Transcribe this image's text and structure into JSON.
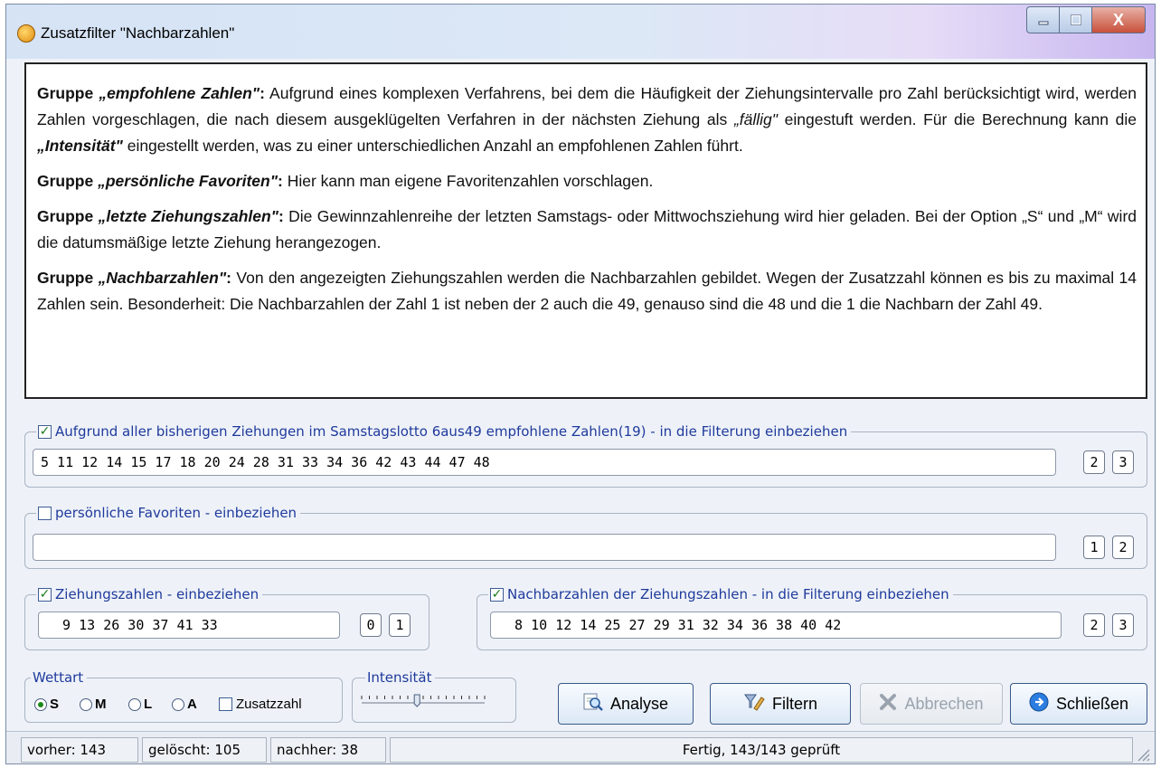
{
  "window": {
    "title": "Zusatzfilter \"Nachbarzahlen\"",
    "controls": {
      "minimize": "_",
      "maximize": "□",
      "close": "X"
    }
  },
  "description": [
    {
      "lead": "Gruppe ",
      "name": "„empfohlene Zahlen\"",
      "colon": ":",
      "text_parts": [
        {
          "t": " Aufgrund eines komplexen Verfahrens, bei dem die Häufigkeit der Ziehungsintervalle pro Zahl berücksichtigt wird, werden Zahlen vorgeschlagen, die nach diesem ausgeklügelten Verfahren in der nächsten Ziehung als "
        },
        {
          "t": "„fällig\"",
          "style": "i"
        },
        {
          "t": " eingestuft werden. Für die Berechnung kann die "
        },
        {
          "t": "„Intensität\"",
          "style": "bi"
        },
        {
          "t": " eingestellt werden, was zu einer unterschiedlichen Anzahl an empfohlenen Zahlen führt."
        }
      ]
    },
    {
      "lead": "Gruppe ",
      "name": "„persönliche Favoriten\"",
      "colon": ":",
      "text_parts": [
        {
          "t": " Hier kann man eigene Favoritenzahlen vorschlagen."
        }
      ]
    },
    {
      "lead": "Gruppe ",
      "name": "„letzte Ziehungszahlen\"",
      "colon": ":",
      "text_parts": [
        {
          "t": " Die Gewinnzahlenreihe der letzten Samstags- oder Mittwochsziehung wird hier geladen. Bei der Option „S“ und „M“ wird die datumsmäßige letzte Ziehung herangezogen."
        }
      ]
    },
    {
      "lead": "Gruppe ",
      "name": "„Nachbarzahlen\"",
      "colon": ":",
      "text_parts": [
        {
          "t": " Von den angezeigten Ziehungszahlen werden die Nachbarzahlen gebildet. Wegen der Zusatzzahl können es bis zu maximal 14 Zahlen sein. Besonderheit: Die Nachbarzahlen der Zahl 1 ist neben der 2 auch die 49, genauso sind die 48 und die 1 die Nachbarn der Zahl 49."
        }
      ]
    }
  ],
  "groups": {
    "recommended": {
      "label": "Aufgrund aller bisherigen Ziehungen im Samstagslotto 6aus49 empfohlene Zahlen(19) - in die Filterung einbeziehen",
      "checked": true,
      "value": "5 11 12 14 15 17 18 20 24 28 31 33 34 36 42 43 44 47 48",
      "btn_a": "2",
      "btn_b": "3"
    },
    "favorites": {
      "label": "persönliche Favoriten  - einbeziehen",
      "checked": false,
      "value": "",
      "btn_a": "1",
      "btn_b": "2"
    },
    "draw": {
      "label": "Ziehungszahlen -  einbeziehen",
      "checked": true,
      "value": "  9 13 26 30 37 41 33",
      "btn_a": "0",
      "btn_b": "1"
    },
    "neighbors": {
      "label": "Nachbarzahlen der Ziehungszahlen - in die Filterung einbeziehen",
      "checked": true,
      "value": "  8 10 12 14 25 27 29 31 32 34 36 38 40 42",
      "btn_a": "2",
      "btn_b": "3"
    }
  },
  "wettart": {
    "label": "Wettart",
    "options": [
      "S",
      "M",
      "L",
      "A"
    ],
    "selected": "S",
    "zusatzzahl_label": "Zusatzzahl",
    "zusatzzahl_checked": false
  },
  "intensitaet": {
    "label": "Intensität",
    "level": 0.45
  },
  "actions": {
    "analyse": "Analyse",
    "filtern": "Filtern",
    "abbrechen": "Abbrechen",
    "schliessen": "Schließen"
  },
  "status": {
    "vorher": "vorher: 143",
    "geloescht": "gelöscht: 105",
    "nachher": "nachher: 38",
    "message": "Fertig, 143/143 geprüft"
  },
  "colors": {
    "legend": "#1f3a9c",
    "check": "#1a7d1a",
    "window_bg": "#eef2f8"
  }
}
